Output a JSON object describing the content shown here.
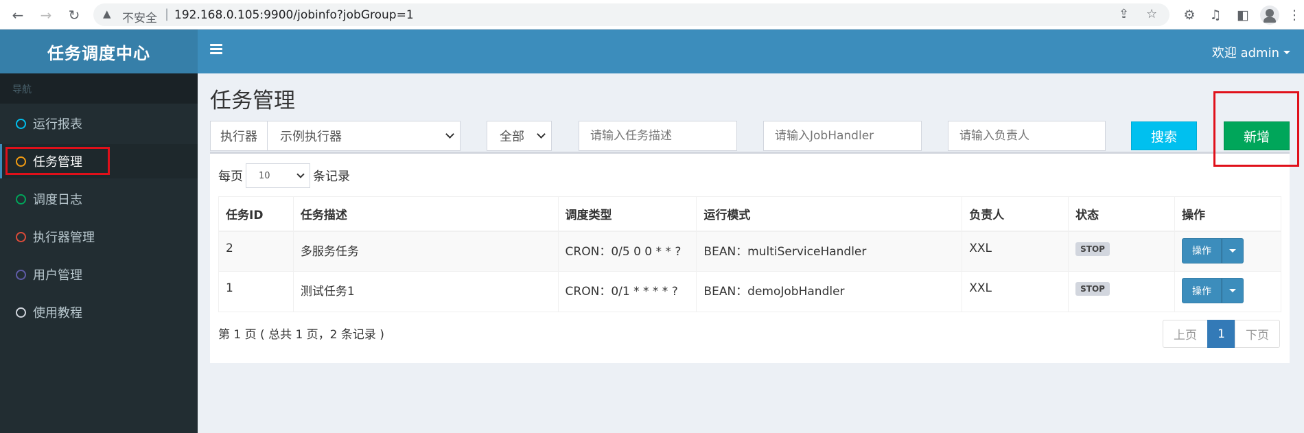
{
  "browser": {
    "insecure_label": "不安全",
    "url": "192.168.0.105:9900/jobinfo?jobGroup=1",
    "back_icon": "arrow-left-icon",
    "forward_icon": "arrow-right-icon",
    "reload_icon": "reload-icon"
  },
  "app": {
    "title": "任务调度中心"
  },
  "topbar": {
    "welcome": "欢迎 admin"
  },
  "sidebar": {
    "header": "导航",
    "items": [
      {
        "label": "运行报表",
        "color": "#00c0ef"
      },
      {
        "label": "任务管理",
        "color": "#f39c12"
      },
      {
        "label": "调度日志",
        "color": "#00a65a"
      },
      {
        "label": "执行器管理",
        "color": "#dd4b39"
      },
      {
        "label": "用户管理",
        "color": "#605ca8"
      },
      {
        "label": "使用教程",
        "color": "#d2d6de"
      }
    ]
  },
  "page": {
    "title": "任务管理",
    "executor_label": "执行器",
    "executor_value": "示例执行器",
    "status_value": "全部",
    "desc_placeholder": "请输入任务描述",
    "handler_placeholder": "请输入JobHandler",
    "author_placeholder": "请输入负责人",
    "search_label": "搜索",
    "add_label": "新增"
  },
  "table": {
    "perpage_prefix": "每页",
    "perpage_value": "10",
    "perpage_suffix": "条记录",
    "headers": [
      "任务ID",
      "任务描述",
      "调度类型",
      "运行模式",
      "负责人",
      "状态",
      "操作"
    ],
    "rows": [
      {
        "id": "2",
        "desc": "多服务任务",
        "schedule": "CRON：0/5 0 0 * * ?",
        "mode": "BEAN：multiServiceHandler",
        "author": "XXL",
        "status": "STOP",
        "op": "操作"
      },
      {
        "id": "1",
        "desc": "测试任务1",
        "schedule": "CRON：0/1 * * * * ?",
        "mode": "BEAN：demoJobHandler",
        "author": "XXL",
        "status": "STOP",
        "op": "操作"
      }
    ],
    "info": "第 1 页 ( 总共 1 页，2 条记录 )",
    "pager": {
      "prev": "上页",
      "current": "1",
      "next": "下页"
    }
  }
}
